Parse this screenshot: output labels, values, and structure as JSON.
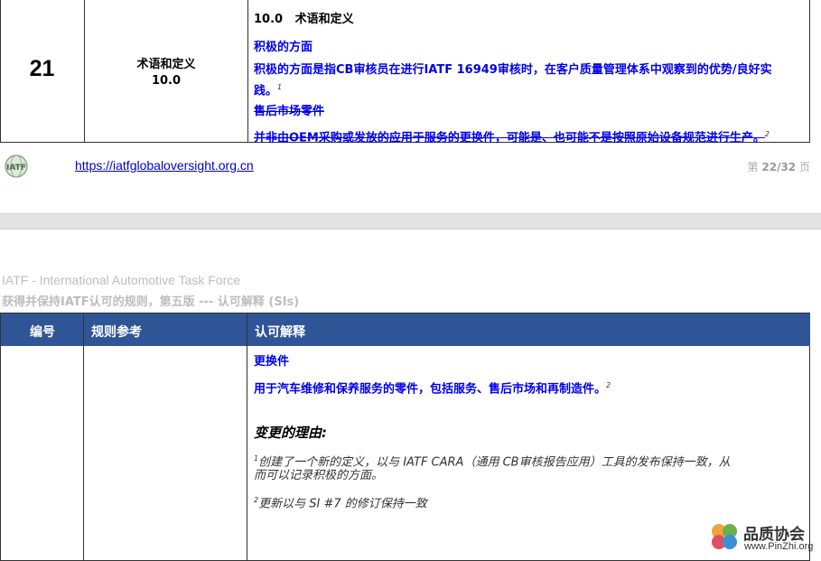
{
  "top_row": {
    "number": "21",
    "ref_title": "术语和定义",
    "ref_code": "10.0",
    "heading": "10.0   术语和定义",
    "term1_title": "积极的方面",
    "term1_body_line1": "积极的方面是指CB审核员在进行IATF 16949审核时，在客户质量管理体系中观察到的优势/良好实",
    "term1_body_line2": "践。",
    "term1_note": "1",
    "term2_title": "售后市场零件",
    "term2_body": "并非由OEM采购或发放的应用于服务的更换件，可能是、也可能不是按照原始设备规范进行生产。",
    "term2_note": "2"
  },
  "footer": {
    "link": "https://iatfglobaloversight.org.cn",
    "page_prefix": "第",
    "page_current": "22",
    "page_sep": "/",
    "page_total": "32",
    "page_suffix": "页"
  },
  "header": {
    "org": "IATF - International Automotive Task Force",
    "doc_title": "获得并保持IATF认可的规则，第五版 --- 认可解释 (SIs)"
  },
  "table": {
    "columns": [
      "编号",
      "规则参考",
      "认可解释"
    ]
  },
  "bottom_row": {
    "term_title": "更换件",
    "term_body": "用于汽车维修和保养服务的零件，包括服务、售后市场和再制造件。",
    "term_note": "2",
    "reason_heading": "变更的理由:",
    "reason1_note": "1",
    "reason1_line1": "创建了一个新的定义，以与 IATF CARA（通用 CB审核报告应用）工具的发布保持一致，从",
    "reason1_line2": "而可以记录积极的方面。",
    "reason2_note": "2",
    "reason2_text": "更新以与 SI #7 的修订保持一致"
  },
  "watermark": {
    "name": "品质协会",
    "url": "www.PinZhi.org"
  }
}
